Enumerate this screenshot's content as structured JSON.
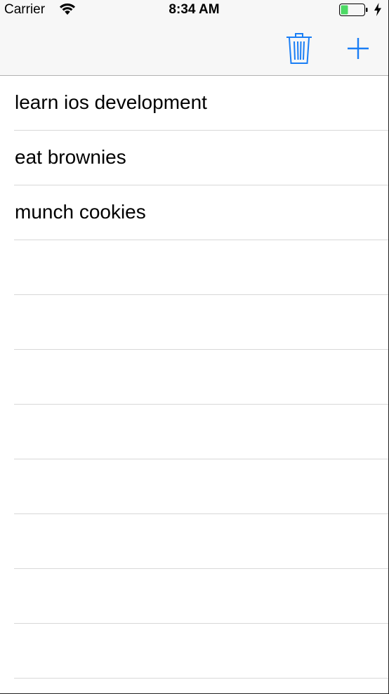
{
  "status_bar": {
    "carrier": "Carrier",
    "time": "8:34 AM",
    "wifi_icon": "wifi-icon",
    "battery_icon": "battery-charging-icon"
  },
  "nav_bar": {
    "trash_icon": "trash-icon",
    "add_icon": "plus-icon",
    "tint_color": "#1a7ef5"
  },
  "table": {
    "rows": [
      {
        "label": "learn ios development"
      },
      {
        "label": "eat brownies"
      },
      {
        "label": "munch cookies"
      },
      {
        "label": ""
      },
      {
        "label": ""
      },
      {
        "label": ""
      },
      {
        "label": ""
      },
      {
        "label": ""
      },
      {
        "label": ""
      },
      {
        "label": ""
      },
      {
        "label": ""
      }
    ]
  },
  "colors": {
    "bar_background": "#f7f7f7",
    "separator": "#d8d8d8",
    "battery_fill": "#4cd964"
  }
}
